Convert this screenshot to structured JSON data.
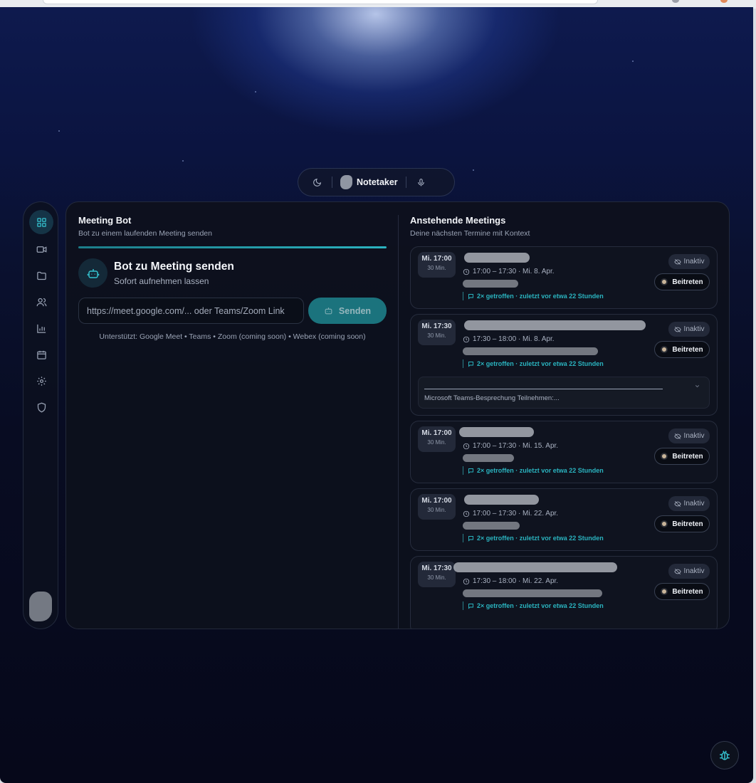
{
  "header": {
    "theme_icon": "moon-icon",
    "brand_logo": "notetaker-logo",
    "brand_name": "Notetaker",
    "mic_icon": "microphone-icon"
  },
  "sidebar": {
    "items": [
      {
        "icon": "dashboard-icon",
        "active": true
      },
      {
        "icon": "video-icon",
        "active": false
      },
      {
        "icon": "folder-icon",
        "active": false
      },
      {
        "icon": "users-icon",
        "active": false
      },
      {
        "icon": "chart-icon",
        "active": false
      },
      {
        "icon": "calendar-icon",
        "active": false
      },
      {
        "icon": "settings-icon",
        "active": false
      },
      {
        "icon": "shield-icon",
        "active": false
      }
    ],
    "avatar": "user-avatar"
  },
  "meeting_bot": {
    "title": "Meeting Bot",
    "subtitle": "Bot zu einem laufenden Meeting senden",
    "send_title": "Bot zu Meeting senden",
    "send_subtitle": "Sofort aufnehmen lassen",
    "input_placeholder": "https://meet.google.com/... oder Teams/Zoom Link",
    "input_value": "",
    "send_label": "Senden",
    "supported": "Unterstützt: Google Meet • Teams • Zoom (coming soon) • Webex (coming soon)",
    "accent_color": "#2bb3c0"
  },
  "upcoming": {
    "title": "Anstehende Meetings",
    "subtitle": "Deine nächsten Termine mit Kontext",
    "status_label": "Inaktiv",
    "join_label": "Beitreten",
    "meetings": [
      {
        "day": "Mi. 17:00",
        "duration": "30 Min.",
        "time": "17:00 – 17:30 · Mi. 8. Apr.",
        "context": "2× getroffen · zuletzt vor etwa 22 Stunden"
      },
      {
        "day": "Mi. 17:30",
        "duration": "30 Min.",
        "time": "17:30 – 18:00 · Mi. 8. Apr.",
        "context": "2× getroffen · zuletzt vor etwa 22 Stunden",
        "description": "Microsoft Teams-Besprechung Teilnehmen:..."
      },
      {
        "day": "Mi. 17:00",
        "duration": "30 Min.",
        "time": "17:00 – 17:30 · Mi. 15. Apr.",
        "context": "2× getroffen · zuletzt vor etwa 22 Stunden"
      },
      {
        "day": "Mi. 17:00",
        "duration": "30 Min.",
        "time": "17:00 – 17:30 · Mi. 22. Apr.",
        "context": "2× getroffen · zuletzt vor etwa 22 Stunden"
      },
      {
        "day": "Mi. 17:30",
        "duration": "30 Min.",
        "time": "17:30 – 18:00 · Mi. 22. Apr.",
        "context": "2× getroffen · zuletzt vor etwa 22 Stunden"
      }
    ]
  },
  "debug_button": "bug-icon"
}
